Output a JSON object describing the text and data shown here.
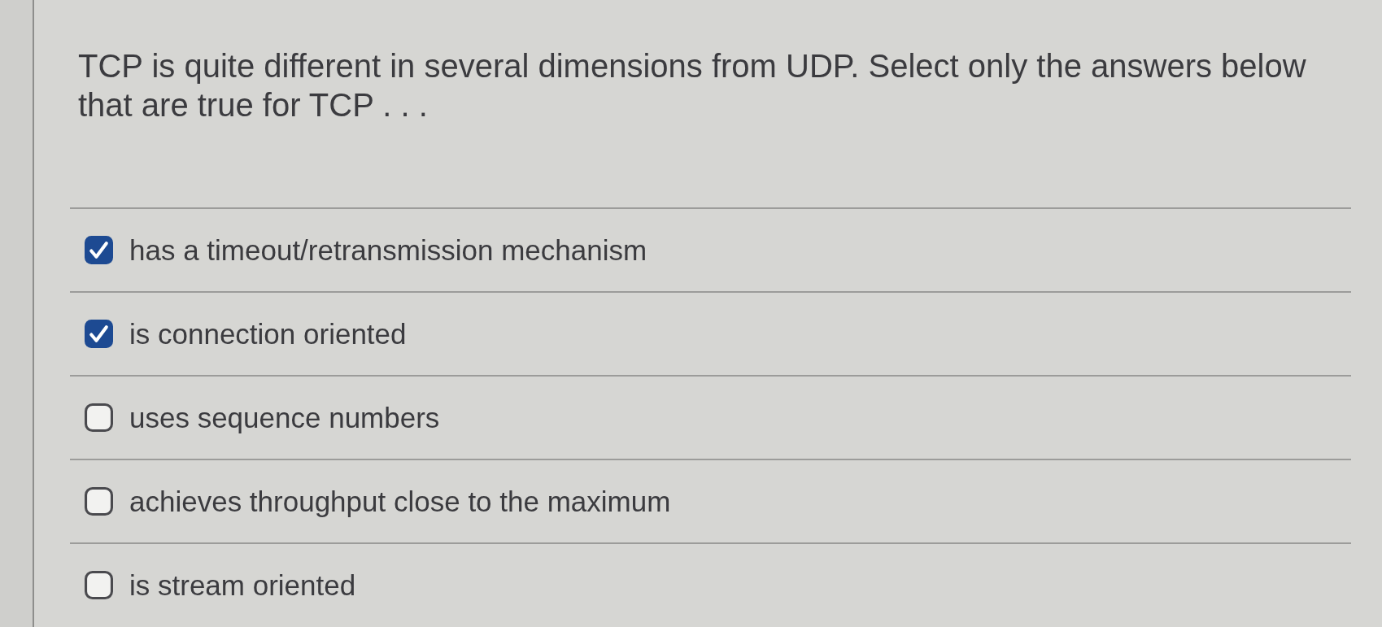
{
  "question": "TCP is quite different in several dimensions from UDP. Select only the answers below that are true for TCP . . .",
  "options": [
    {
      "label": "has a timeout/retransmission mechanism",
      "checked": true
    },
    {
      "label": "is connection oriented",
      "checked": true
    },
    {
      "label": "uses sequence numbers",
      "checked": false
    },
    {
      "label": "achieves throughput close to the maximum",
      "checked": false
    },
    {
      "label": "is stream oriented",
      "checked": false
    }
  ]
}
